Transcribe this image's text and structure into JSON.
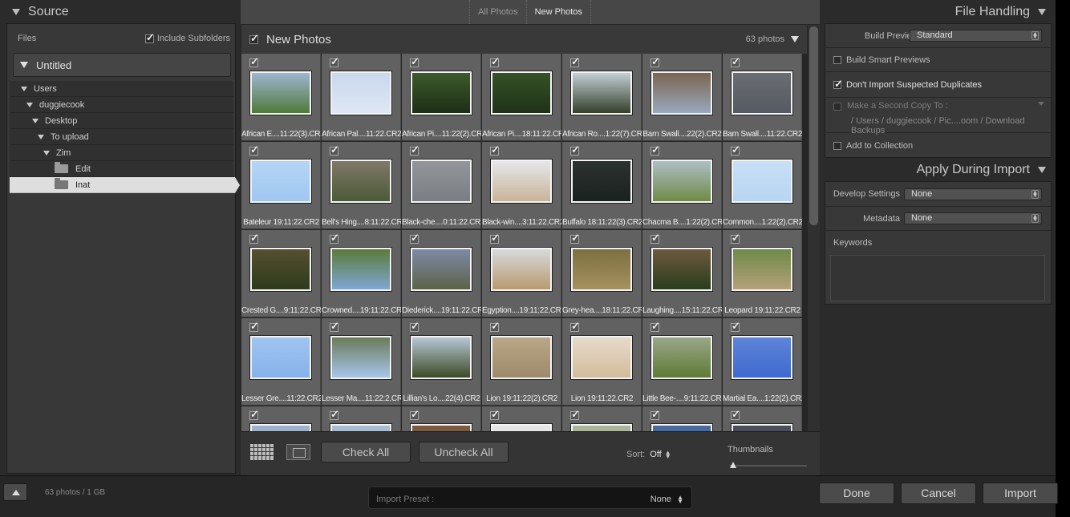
{
  "left_panel": {
    "title": "Source",
    "files_label": "Files",
    "include_subfolders": "Include Subfolders",
    "volume": "Untitled",
    "tree": [
      {
        "label": "Users",
        "indent": 1,
        "type": "expanded"
      },
      {
        "label": "duggiecook",
        "indent": 2,
        "type": "expanded"
      },
      {
        "label": "Desktop",
        "indent": 3,
        "type": "expanded"
      },
      {
        "label": "To upload",
        "indent": 4,
        "type": "expanded"
      },
      {
        "label": "Zim",
        "indent": 5,
        "type": "expanded"
      },
      {
        "label": "Edit",
        "indent": 6,
        "type": "folder"
      },
      {
        "label": "Inat",
        "indent": 6,
        "type": "folder",
        "selected": true
      }
    ]
  },
  "tabs": {
    "all": "All Photos",
    "new": "New Photos"
  },
  "grid_header": {
    "title": "New Photos",
    "count": "63 photos"
  },
  "photos": [
    {
      "name": "African E....11:22(3).CR2",
      "colors": [
        "#4f7a3a",
        "#9fb5d0"
      ]
    },
    {
      "name": "African Pal....11:22.CR2",
      "colors": [
        "#dfe7f4",
        "#c9d7ee"
      ]
    },
    {
      "name": "African Pi....11:22(2).CR2",
      "colors": [
        "#1e2e17",
        "#3c5a2a"
      ]
    },
    {
      "name": "African Pi....18:11:22.CR2",
      "colors": [
        "#1f3218",
        "#355225"
      ]
    },
    {
      "name": "African Ro....1:22(7).CR2",
      "colors": [
        "#34402a",
        "#c3cfd6"
      ]
    },
    {
      "name": "Barn Swall....22(2).CR2",
      "colors": [
        "#9aa8bd",
        "#7a6650"
      ]
    },
    {
      "name": "Barn Swall....11:22.CR2",
      "colors": [
        "#555a62",
        "#6a6d72"
      ]
    },
    {
      "name": "Bateleur 19:11:22.CR2",
      "colors": [
        "#9fc7f0",
        "#b5d5f5"
      ]
    },
    {
      "name": "Bell's Hing....8:11:22.CR2",
      "colors": [
        "#4b5a38",
        "#7f7968"
      ]
    },
    {
      "name": "Black-che....0:11:22.CR2",
      "colors": [
        "#7a7d83",
        "#93969b"
      ]
    },
    {
      "name": "Black-win....3:11:22.CR2",
      "colors": [
        "#c8b39a",
        "#e6e8ea"
      ]
    },
    {
      "name": "Buffalo 18:11:22(3).CR2",
      "colors": [
        "#1a2220",
        "#2c3230"
      ]
    },
    {
      "name": "Chacma B....1:22(2).CR2",
      "colors": [
        "#6f8a46",
        "#aebfc6"
      ]
    },
    {
      "name": "Common....1:22(2).CR2",
      "colors": [
        "#b8d5f2",
        "#c8dff5"
      ]
    },
    {
      "name": "Crested G....9:11:22.CR2",
      "colors": [
        "#2d3a1d",
        "#56502f"
      ]
    },
    {
      "name": "Crowned....19:11:22.CR2",
      "colors": [
        "#7fa7d6",
        "#5b7a38"
      ]
    },
    {
      "name": "Diederick....19:11:22.CR2",
      "colors": [
        "#5c6248",
        "#7e8aa6"
      ]
    },
    {
      "name": "Egyption....19:11:22.CR2",
      "colors": [
        "#b89a70",
        "#d7dadb"
      ]
    },
    {
      "name": "Grey-hea....18:11:22.CR2",
      "colors": [
        "#a6905f",
        "#7c7040"
      ]
    },
    {
      "name": "Laughing....15:11:22.CR2",
      "colors": [
        "#2a3d1e",
        "#6d5a3d"
      ]
    },
    {
      "name": "Leopard 19:11:22.CR2",
      "colors": [
        "#b5a07a",
        "#6e8a48"
      ]
    },
    {
      "name": "Lesser Gre....11:22.CR2",
      "colors": [
        "#86b2ea",
        "#a0c4f0"
      ]
    },
    {
      "name": "Lesser Ma....11:22:2.CR2",
      "colors": [
        "#a8c6ea",
        "#6a7a5a"
      ]
    },
    {
      "name": "Lillian's Lo....22(4).CR2",
      "colors": [
        "#3c4a26",
        "#b7c7d5"
      ]
    },
    {
      "name": "Lion 19:11:22(2).CR2",
      "colors": [
        "#9c8a6c",
        "#b9a787"
      ]
    },
    {
      "name": "Lion 19:11:22.CR2",
      "colors": [
        "#d2bc9a",
        "#e7dacb"
      ]
    },
    {
      "name": "Little Bee-....9:11:22.CR2",
      "colors": [
        "#5f7a35",
        "#9aa78a"
      ]
    },
    {
      "name": "Martial Ea....1:22(2).CR2",
      "colors": [
        "#3e6acf",
        "#5f84d8"
      ]
    },
    {
      "name": "",
      "colors": [
        "#9fb2cc",
        "#9fb2cc"
      ]
    },
    {
      "name": "",
      "colors": [
        "#a9bbd0",
        "#a9bbd0"
      ]
    },
    {
      "name": "",
      "colors": [
        "#7a5a40",
        "#7a5a40"
      ]
    },
    {
      "name": "",
      "colors": [
        "#e5e5e5",
        "#e5e5e5"
      ]
    },
    {
      "name": "",
      "colors": [
        "#aab59a",
        "#aab59a"
      ]
    },
    {
      "name": "",
      "colors": [
        "#4b6a9a",
        "#4b6a9a"
      ]
    },
    {
      "name": "",
      "colors": [
        "#4a4e5a",
        "#4a4e5a"
      ]
    }
  ],
  "toolbar": {
    "check_all": "Check All",
    "uncheck_all": "Uncheck All",
    "sort_label": "Sort:",
    "sort_value": "Off",
    "thumbnails_label": "Thumbnails"
  },
  "right_panel": {
    "file_handling_title": "File Handling",
    "build_previews_label": "Build Previews",
    "build_previews_value": "Standard",
    "smart_previews": "Build Smart Previews",
    "no_duplicates": "Don't Import Suspected Duplicates",
    "second_copy": "Make a Second Copy To :",
    "second_copy_path": "/ Users / duggiecook / Pic....oom / Download Backups",
    "add_to_collection": "Add to Collection",
    "apply_title": "Apply During Import",
    "develop_label": "Develop Settings",
    "develop_value": "None",
    "metadata_label": "Metadata",
    "metadata_value": "None",
    "keywords_label": "Keywords"
  },
  "bottom": {
    "summary": "63 photos / 1 GB",
    "preset_label": "Import Preset :",
    "preset_value": "None",
    "done": "Done",
    "cancel": "Cancel",
    "import": "Import"
  }
}
